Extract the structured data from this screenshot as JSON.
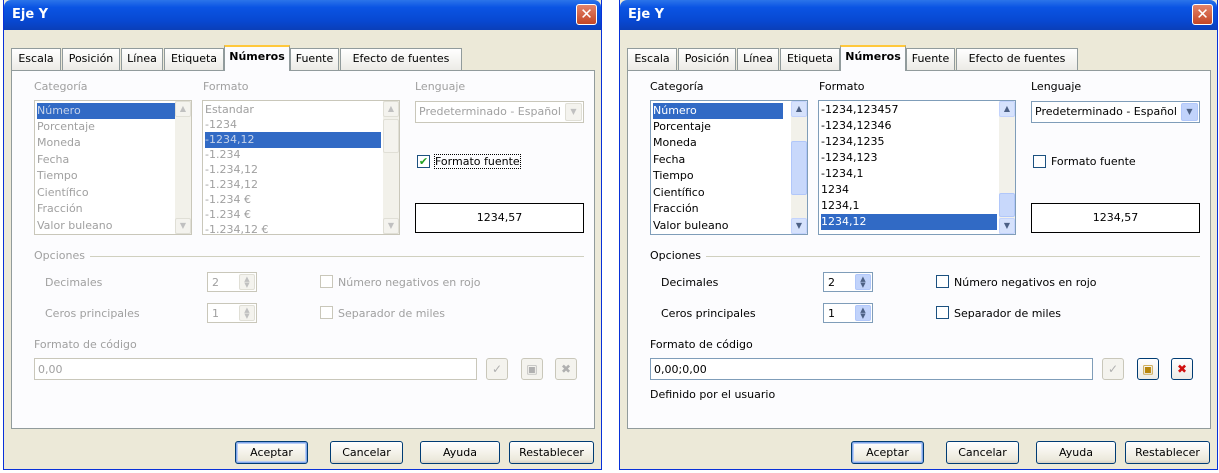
{
  "dialogs": [
    {
      "title": "Eje Y",
      "tabs": [
        "Escala",
        "Posición",
        "Línea",
        "Etiqueta",
        "Números",
        "Fuente",
        "Efecto de fuentes"
      ],
      "active_tab": "Números",
      "categoria_label": "Categoría",
      "formato_label": "Formato",
      "lenguaje_label": "Lenguaje",
      "categorias": [
        "Número",
        "Porcentaje",
        "Moneda",
        "Fecha",
        "Tiempo",
        "Científico",
        "Fracción",
        "Valor buleano"
      ],
      "formatos": [
        "Estandar",
        "-1234",
        "-1234,12",
        "-1.234",
        "-1.234,12",
        "-1.234,12",
        "-1.234 €",
        "-1.234 €",
        "-1.234,12 €"
      ],
      "lenguaje_value": "Predeterminado - Español",
      "formato_fuente_label": "Formato fuente",
      "formato_fuente_checked": true,
      "preview_value": "1234,57",
      "opciones_label": "Opciones",
      "decimales_label": "Decimales",
      "decimales_value": "2",
      "ceros_label": "Ceros principales",
      "ceros_value": "1",
      "negativos_label": "Número negativos en rojo",
      "separador_label": "Separador de miles",
      "formato_codigo_label": "Formato de código",
      "formato_codigo_value": "0,00",
      "user_defined_text": ""
    },
    {
      "title": "Eje Y",
      "tabs": [
        "Escala",
        "Posición",
        "Línea",
        "Etiqueta",
        "Números",
        "Fuente",
        "Efecto de fuentes"
      ],
      "active_tab": "Números",
      "categoria_label": "Categoría",
      "formato_label": "Formato",
      "lenguaje_label": "Lenguaje",
      "categorias": [
        "Número",
        "Porcentaje",
        "Moneda",
        "Fecha",
        "Tiempo",
        "Científico",
        "Fracción",
        "Valor buleano"
      ],
      "formatos": [
        "-1234,123457",
        "-1234,12346",
        "-1234,1235",
        "-1234,123",
        "-1234,1",
        "1234",
        "1234,1",
        "1234,12"
      ],
      "lenguaje_value": "Predeterminado - Español",
      "formato_fuente_label": "Formato fuente",
      "formato_fuente_checked": false,
      "preview_value": "1234,57",
      "opciones_label": "Opciones",
      "decimales_label": "Decimales",
      "decimales_value": "2",
      "ceros_label": "Ceros principales",
      "ceros_value": "1",
      "negativos_label": "Número negativos en rojo",
      "separador_label": "Separador de miles",
      "formato_codigo_label": "Formato de código",
      "formato_codigo_value": "0,00;0,00",
      "user_defined_text": "Definido por el usuario"
    }
  ],
  "buttons": {
    "aceptar": "Aceptar",
    "cancelar": "Cancelar",
    "ayuda": "Ayuda",
    "restablecer": "Restablecer"
  },
  "colors": {
    "title_bar": "#0a54e3",
    "selection": "#316ac5",
    "dialog_bg": "#ece9d8",
    "close_button": "#c44625"
  }
}
